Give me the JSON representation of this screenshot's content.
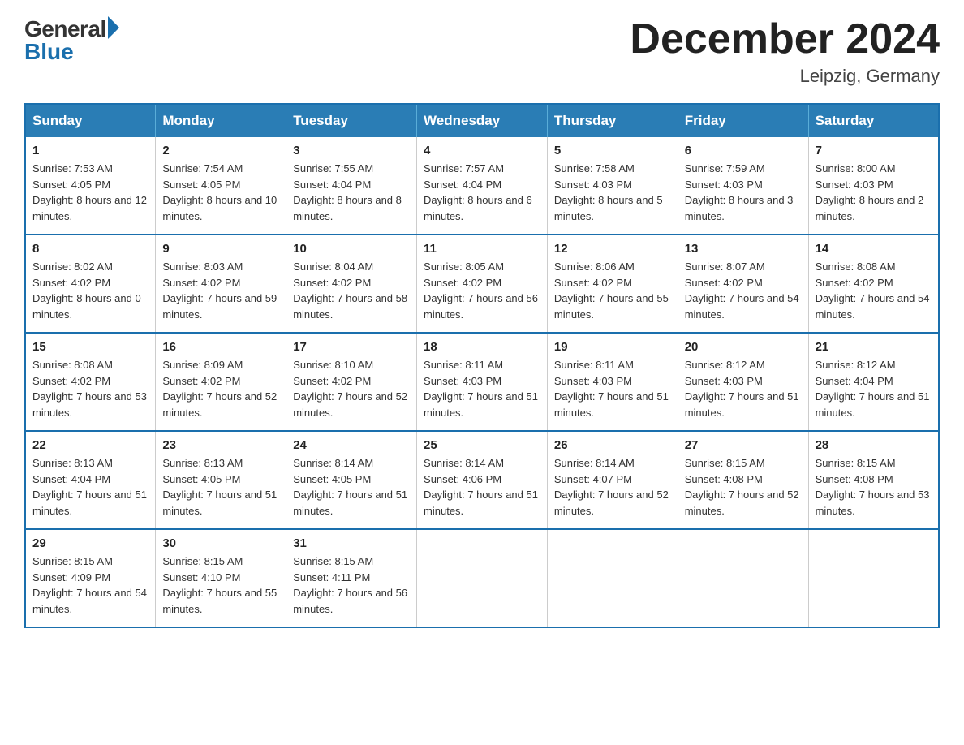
{
  "header": {
    "logo_general": "General",
    "logo_blue": "Blue",
    "month_title": "December 2024",
    "location": "Leipzig, Germany"
  },
  "days_of_week": [
    "Sunday",
    "Monday",
    "Tuesday",
    "Wednesday",
    "Thursday",
    "Friday",
    "Saturday"
  ],
  "weeks": [
    [
      {
        "day": "1",
        "sunrise": "7:53 AM",
        "sunset": "4:05 PM",
        "daylight": "8 hours and 12 minutes."
      },
      {
        "day": "2",
        "sunrise": "7:54 AM",
        "sunset": "4:05 PM",
        "daylight": "8 hours and 10 minutes."
      },
      {
        "day": "3",
        "sunrise": "7:55 AM",
        "sunset": "4:04 PM",
        "daylight": "8 hours and 8 minutes."
      },
      {
        "day": "4",
        "sunrise": "7:57 AM",
        "sunset": "4:04 PM",
        "daylight": "8 hours and 6 minutes."
      },
      {
        "day": "5",
        "sunrise": "7:58 AM",
        "sunset": "4:03 PM",
        "daylight": "8 hours and 5 minutes."
      },
      {
        "day": "6",
        "sunrise": "7:59 AM",
        "sunset": "4:03 PM",
        "daylight": "8 hours and 3 minutes."
      },
      {
        "day": "7",
        "sunrise": "8:00 AM",
        "sunset": "4:03 PM",
        "daylight": "8 hours and 2 minutes."
      }
    ],
    [
      {
        "day": "8",
        "sunrise": "8:02 AM",
        "sunset": "4:02 PM",
        "daylight": "8 hours and 0 minutes."
      },
      {
        "day": "9",
        "sunrise": "8:03 AM",
        "sunset": "4:02 PM",
        "daylight": "7 hours and 59 minutes."
      },
      {
        "day": "10",
        "sunrise": "8:04 AM",
        "sunset": "4:02 PM",
        "daylight": "7 hours and 58 minutes."
      },
      {
        "day": "11",
        "sunrise": "8:05 AM",
        "sunset": "4:02 PM",
        "daylight": "7 hours and 56 minutes."
      },
      {
        "day": "12",
        "sunrise": "8:06 AM",
        "sunset": "4:02 PM",
        "daylight": "7 hours and 55 minutes."
      },
      {
        "day": "13",
        "sunrise": "8:07 AM",
        "sunset": "4:02 PM",
        "daylight": "7 hours and 54 minutes."
      },
      {
        "day": "14",
        "sunrise": "8:08 AM",
        "sunset": "4:02 PM",
        "daylight": "7 hours and 54 minutes."
      }
    ],
    [
      {
        "day": "15",
        "sunrise": "8:08 AM",
        "sunset": "4:02 PM",
        "daylight": "7 hours and 53 minutes."
      },
      {
        "day": "16",
        "sunrise": "8:09 AM",
        "sunset": "4:02 PM",
        "daylight": "7 hours and 52 minutes."
      },
      {
        "day": "17",
        "sunrise": "8:10 AM",
        "sunset": "4:02 PM",
        "daylight": "7 hours and 52 minutes."
      },
      {
        "day": "18",
        "sunrise": "8:11 AM",
        "sunset": "4:03 PM",
        "daylight": "7 hours and 51 minutes."
      },
      {
        "day": "19",
        "sunrise": "8:11 AM",
        "sunset": "4:03 PM",
        "daylight": "7 hours and 51 minutes."
      },
      {
        "day": "20",
        "sunrise": "8:12 AM",
        "sunset": "4:03 PM",
        "daylight": "7 hours and 51 minutes."
      },
      {
        "day": "21",
        "sunrise": "8:12 AM",
        "sunset": "4:04 PM",
        "daylight": "7 hours and 51 minutes."
      }
    ],
    [
      {
        "day": "22",
        "sunrise": "8:13 AM",
        "sunset": "4:04 PM",
        "daylight": "7 hours and 51 minutes."
      },
      {
        "day": "23",
        "sunrise": "8:13 AM",
        "sunset": "4:05 PM",
        "daylight": "7 hours and 51 minutes."
      },
      {
        "day": "24",
        "sunrise": "8:14 AM",
        "sunset": "4:05 PM",
        "daylight": "7 hours and 51 minutes."
      },
      {
        "day": "25",
        "sunrise": "8:14 AM",
        "sunset": "4:06 PM",
        "daylight": "7 hours and 51 minutes."
      },
      {
        "day": "26",
        "sunrise": "8:14 AM",
        "sunset": "4:07 PM",
        "daylight": "7 hours and 52 minutes."
      },
      {
        "day": "27",
        "sunrise": "8:15 AM",
        "sunset": "4:08 PM",
        "daylight": "7 hours and 52 minutes."
      },
      {
        "day": "28",
        "sunrise": "8:15 AM",
        "sunset": "4:08 PM",
        "daylight": "7 hours and 53 minutes."
      }
    ],
    [
      {
        "day": "29",
        "sunrise": "8:15 AM",
        "sunset": "4:09 PM",
        "daylight": "7 hours and 54 minutes."
      },
      {
        "day": "30",
        "sunrise": "8:15 AM",
        "sunset": "4:10 PM",
        "daylight": "7 hours and 55 minutes."
      },
      {
        "day": "31",
        "sunrise": "8:15 AM",
        "sunset": "4:11 PM",
        "daylight": "7 hours and 56 minutes."
      },
      null,
      null,
      null,
      null
    ]
  ]
}
